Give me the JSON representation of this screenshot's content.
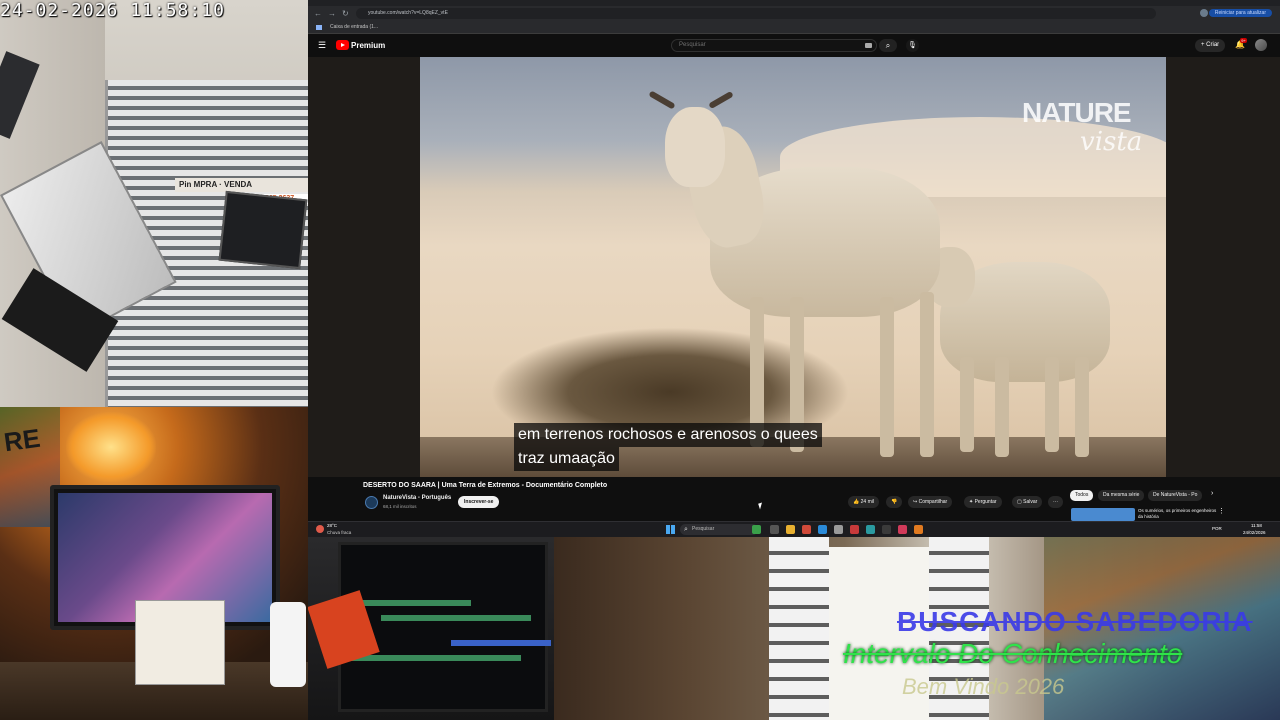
{
  "camera": {
    "timestamp": "24-02-2026  11:58:10",
    "shop_sign": "Pin   MPRA  ·  VENDA",
    "shop_phone": "865 3637",
    "mural_text": "RE",
    "overlay_title": "BUSCANDO SABEDORIA",
    "overlay_subtitle": "Intervalo Do Conhecimento",
    "overlay_welcome": "Bem Vindo 2026"
  },
  "browser": {
    "url": "youtube.com/watch?v=LQ8qEZ_vtE",
    "reload_label": "Reiniciar para atualizar",
    "bookmark": "Caixa de entrada (1..."
  },
  "youtube": {
    "brand": "Premium",
    "search_placeholder": "Pesquisar",
    "create_label": "+ Criar",
    "notification_count": "9+",
    "video": {
      "watermark_top": "NATURE",
      "watermark_bottom": "vista",
      "caption_line_1": "em terrenos rochosos e arenosos o quees",
      "caption_line_2": "traz umaação",
      "title": "DESERTO DO SAARA | Uma Terra de Extremos - Documentário Completo",
      "channel": "NatureVista - Português",
      "subscribers": "68,1 mil inscritos",
      "subscribe_label": "Inscrever-se",
      "likes": "24 mil",
      "share_label": "Compartilhar",
      "ask_label": "Perguntar",
      "save_label": "Salvar",
      "more_label": "···"
    },
    "chips": {
      "all": "Todos",
      "series": "Da mesma série",
      "channel": "De NatureVista - Po"
    },
    "recommendation": {
      "title": "Os sumérios, os primeiros engenheiros da história"
    }
  },
  "taskbar": {
    "temperature": "28°C",
    "weather": "Chuva fraca",
    "search_placeholder": "Pesquisar",
    "language": "POR",
    "time": "11:58",
    "date": "24/02/2026"
  },
  "colors": {
    "youtube_red": "#ff0000",
    "overlay_green": "#2fe34a",
    "overlay_blue": "#3a3ae8"
  }
}
